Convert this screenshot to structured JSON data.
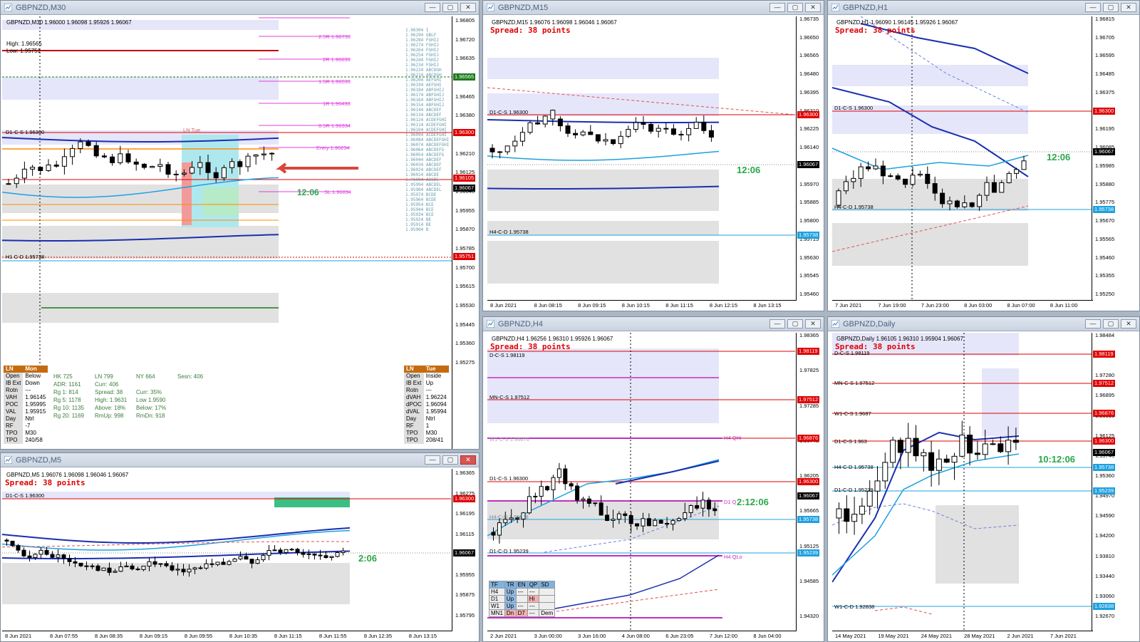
{
  "windows": {
    "m30": {
      "title": "GBPNZD,M30",
      "ohlc": "GBPNZD,M30  1.96000 1.96098 1.95926 1.96067",
      "high_label": "High: 1.96565",
      "low_label": "Low: 1.95751",
      "timer": "12:06",
      "levels": {
        "d1cs": "D1-C-S 1.96300",
        "h1cd": "H1 C-D 1.95738",
        "r25": "2.5R 1.96733",
        "r2": "2R 1.96633",
        "r15": "1.5R 1.96533",
        "r1": "1R 1.96433",
        "r05": "0.5R 1.96334",
        "entry": "Entry 1.96234",
        "sl": "SL 1.96034",
        "ln_tue": "LN Tue"
      },
      "axis_ticks": [
        "1.96805",
        "1.96720",
        "1.96635",
        "1.96550",
        "1.96465",
        "1.96380",
        "1.96295",
        "1.96210",
        "1.96125",
        "1.96040",
        "1.95955",
        "1.95870",
        "1.95785",
        "1.95700",
        "1.95615",
        "1.95530",
        "1.95445",
        "1.95360",
        "1.95275"
      ],
      "price_labels": [
        {
          "text": "1.96565",
          "color": "#1b7a1b"
        },
        {
          "text": "1.96300",
          "color": "#e00000"
        },
        {
          "text": "1.96105",
          "color": "#e00000"
        },
        {
          "text": "1.96067",
          "color": "#000000"
        },
        {
          "text": "1.95751",
          "color": "#e00000"
        }
      ],
      "ladder": [
        "1.96304 I",
        "1.96294 GBLF",
        "1.96284 FGHIJ",
        "1.96274 FGHIJ",
        "1.96264 FGHIJ",
        "1.96254 FGHIJ",
        "1.96244 FGHIJ",
        "1.96234 FGHIJ",
        "1.96224 ABCDGH",
        "1.96214 ABCDGH",
        "1.96204 AEFGHI",
        "1.96194 AEFGHI",
        "1.96184 ABFGHIJ",
        "1.96174 ABFGHIJ",
        "1.96164 ABFGHIJ",
        "1.96154 ABFGHIJ",
        "1.96144 ABCDEF",
        "1.96134 ABCDEF",
        "1.96124 ACDEFGHI",
        "1.96114 ACDEFGHI",
        "1.96104 ACDEFGHI",
        "1.96094 ACDEFGHI",
        "1.96084 ABCDEFGHI",
        "1.96074 ABCDEFGHI",
        "1.96064 ABCDEFG",
        "1.96054 ABCDEFG",
        "1.96044 ABCDEF",
        "1.96034 ABCDEF",
        "1.96024 ABCDEF",
        "1.96014 ABCDE",
        "1.96004 ABCDE",
        "1.95994 ABCDEL",
        "1.95984 ABCDEL",
        "1.95974 BCDE",
        "1.95964 BCDE",
        "1.95954 BCE",
        "1.95944 BCE",
        "1.95934 BCE",
        "1.95924 BE",
        "1.95914 BE",
        "1.95904 B"
      ],
      "profile_mon": {
        "header": [
          "LN",
          "Mon"
        ],
        "rows": [
          [
            "Open",
            "Below"
          ],
          [
            "IB Ext",
            "Down"
          ],
          [
            "Rotn",
            "---"
          ],
          [
            "VAH",
            "1.96145"
          ],
          [
            "POC",
            "1.95995"
          ],
          [
            "VAL",
            "1.95915"
          ],
          [
            "Day",
            "Ntrl"
          ],
          [
            "RF",
            "-7"
          ],
          [
            "TPO",
            "M30"
          ],
          [
            "TPO",
            "240/58"
          ]
        ]
      },
      "profile_tue": {
        "header": [
          "LN",
          "Tue"
        ],
        "rows": [
          [
            "Open",
            "Inside"
          ],
          [
            "IB Ext",
            "Up"
          ],
          [
            "Rotn",
            "---"
          ],
          [
            "dVAH",
            "1.96224"
          ],
          [
            "dPOC",
            "1.96094"
          ],
          [
            "dVAL",
            "1.95994"
          ],
          [
            "Day",
            "Ntrl"
          ],
          [
            "RF",
            "1"
          ],
          [
            "TPO",
            "M30"
          ],
          [
            "TPO",
            "208/41"
          ]
        ]
      },
      "stats": [
        [
          "HK 725",
          "LN 799",
          "NY 664",
          "Sesn: 406",
          ""
        ],
        [
          "",
          "ADR: 1161",
          "Curr: 406",
          "",
          ""
        ],
        [
          "Rg 1: 814",
          "Spread: 38",
          "Curr: 35%",
          "",
          ""
        ],
        [
          "Rg 5: 1178",
          "High: 1.9631",
          "Low 1.9590",
          "",
          ""
        ],
        [
          "Rg 10: 1135",
          "Above: 18%",
          "Below: 17%",
          "",
          ""
        ],
        [
          "Rg 20: 1169",
          "RmUp: 998",
          "RmDn: 918",
          "",
          ""
        ]
      ]
    },
    "m15": {
      "title": "GBPNZD,M15",
      "ohlc": "GBPNZD,M15  1.96076 1.96098 1.96046 1.96067",
      "spread": "Spread: 38 points",
      "timer": "12:06",
      "levels": {
        "d1cs": "D1-C-S 1.96300",
        "h4cd": "H4-C-D 1.95738"
      },
      "axis_ticks": [
        "1.96735",
        "1.96650",
        "1.96565",
        "1.96480",
        "1.96395",
        "1.96310",
        "1.96225",
        "1.96140",
        "1.96055",
        "1.95970",
        "1.95885",
        "1.95800",
        "1.95715",
        "1.95630",
        "1.95545",
        "1.95460"
      ],
      "price_labels": [
        {
          "text": "1.96300",
          "color": "#e00000"
        },
        {
          "text": "1.96067",
          "color": "#000000"
        },
        {
          "text": "1.95738",
          "color": "#1ea0e0"
        }
      ],
      "xticks": [
        "8 Jun 2021",
        "8 Jun 08:15",
        "8 Jun 09:15",
        "8 Jun 10:15",
        "8 Jun 11:15",
        "8 Jun 12:15",
        "8 Jun 13:15"
      ]
    },
    "h1": {
      "title": "GBPNZD,H1",
      "ohlc": "GBPNZD,H1  1.96090 1.96145 1.95926 1.96067",
      "spread": "Spread: 38 points",
      "timer": "12:06",
      "levels": {
        "d1cs": "D1-C-S 1.96300",
        "h4cd": "H4-C-D 1.95738"
      },
      "axis_ticks": [
        "1.96815",
        "1.96705",
        "1.96595",
        "1.96485",
        "1.96375",
        "1.96265",
        "1.96195",
        "1.96085",
        "1.95985",
        "1.95880",
        "1.95775",
        "1.95670",
        "1.95565",
        "1.95460",
        "1.95355",
        "1.95250"
      ],
      "price_labels": [
        {
          "text": "1.96300",
          "color": "#e00000"
        },
        {
          "text": "1.96067",
          "color": "#000000"
        },
        {
          "text": "1.95738",
          "color": "#1ea0e0"
        }
      ],
      "xticks": [
        "7 Jun 2021",
        "7 Jun 19:00",
        "7 Jun 23:00",
        "8 Jun 03:00",
        "8 Jun 07:00",
        "8 Jun 11:00"
      ]
    },
    "m5": {
      "title": "GBPNZD,M5",
      "ohlc": "GBPNZD,M5  1.96076 1.96098 1.96046 1.96067",
      "spread": "Spread: 38 points",
      "timer": "2:06",
      "levels": {
        "d1cs": "D1-C-S 1.96300"
      },
      "axis_ticks": [
        "1.96365",
        "1.96275",
        "1.96195",
        "1.96115",
        "1.96035",
        "1.95955",
        "1.95875",
        "1.95795"
      ],
      "price_labels": [
        {
          "text": "1.96300",
          "color": "#e00000"
        },
        {
          "text": "1.96067",
          "color": "#000000"
        }
      ],
      "xticks": [
        "8 Jun 2021",
        "8 Jun 07:55",
        "8 Jun 08:35",
        "8 Jun 09:15",
        "8 Jun 09:55",
        "8 Jun 10:35",
        "8 Jun 11:15",
        "8 Jun 11:55",
        "8 Jun 12:35",
        "8 Jun 13:15"
      ]
    },
    "h4": {
      "title": "GBPNZD,H4",
      "ohlc": "GBPNZD,H4  1.96256 1.96310 1.95926 1.96067",
      "spread": "Spread: 38 points",
      "timer": "2:12:06",
      "levels": {
        "dcs": "D-C-S 1.98119",
        "mncs": "MN-C-S 1.97512",
        "w1cs": "W1-C-S 1.96876",
        "d1cs": "D1-C-S 1.96300",
        "h4cd": "H4-C-D 1.95738",
        "d1cd": "D1-C-D 1.95239",
        "h4qhi": "H4 QHi",
        "h4qlo": "H4 QLo",
        "d1q": "D1 Q"
      },
      "axis_ticks": [
        "1.98365",
        "1.97825",
        "1.97285",
        "1.96745",
        "1.96205",
        "1.95665",
        "1.95125",
        "1.94585",
        "1.94320"
      ],
      "price_labels": [
        {
          "text": "1.98119",
          "color": "#e00000"
        },
        {
          "text": "1.97512",
          "color": "#e00000"
        },
        {
          "text": "1.96876",
          "color": "#e00000"
        },
        {
          "text": "1.96300",
          "color": "#e00000"
        },
        {
          "text": "1.96067",
          "color": "#000000"
        },
        {
          "text": "1.95738",
          "color": "#1ea0e0"
        },
        {
          "text": "1.95239",
          "color": "#1ea0e0"
        }
      ],
      "xticks": [
        "2 Jun 2021",
        "3 Jun 00:00",
        "3 Jun 16:00",
        "4 Jun 08:00",
        "6 Jun 23:05",
        "7 Jun 12:00",
        "8 Jun 04:00"
      ],
      "trend_table": {
        "header": [
          "TF",
          "TR",
          "EN",
          "QP",
          "SD"
        ],
        "rows": [
          [
            "H4",
            "Up",
            "---",
            "---",
            ""
          ],
          [
            "D1",
            "Up",
            "",
            "Hi",
            ""
          ],
          [
            "W1",
            "Up",
            "---",
            "---",
            ""
          ],
          [
            "MN1",
            "Dn",
            "D7",
            "---",
            "Dem"
          ]
        ]
      }
    },
    "daily": {
      "title": "GBPNZD,Daily",
      "ohlc": "GBPNZD,Daily  1.96105 1.96310 1.95904 1.96067",
      "spread": "Spread: 38 points",
      "timer": "10:12:06",
      "levels": {
        "dcs": "D-C-S 1.98119",
        "mncs": "MN-C-S 1.97512",
        "w1cs": "W1-C-S 1.9687",
        "d1cs": "D1-C-S 1.963",
        "h4cd": "H4-C-D 1.95738",
        "d1cd": "D1-C-D 1.95239",
        "w1cd": "W1-C-D 1.92838"
      },
      "axis_ticks": [
        "1.98484",
        "1.97670",
        "1.97280",
        "1.96895",
        "1.96510",
        "1.96125",
        "1.95740",
        "1.95360",
        "1.94970",
        "1.94590",
        "1.94200",
        "1.93810",
        "1.93440",
        "1.93060",
        "1.92670"
      ],
      "price_labels": [
        {
          "text": "1.98119",
          "color": "#e00000"
        },
        {
          "text": "1.97512",
          "color": "#e00000"
        },
        {
          "text": "1.96876",
          "color": "#e00000"
        },
        {
          "text": "1.96300",
          "color": "#e00000"
        },
        {
          "text": "1.96067",
          "color": "#000000"
        },
        {
          "text": "1.95738",
          "color": "#1ea0e0"
        },
        {
          "text": "1.95239",
          "color": "#1ea0e0"
        },
        {
          "text": "1.92838",
          "color": "#1ea0e0"
        }
      ],
      "xticks": [
        "14 May 2021",
        "19 May 2021",
        "24 May 2021",
        "28 May 2021",
        "2 Jun 2021",
        "7 Jun 2021"
      ]
    }
  }
}
